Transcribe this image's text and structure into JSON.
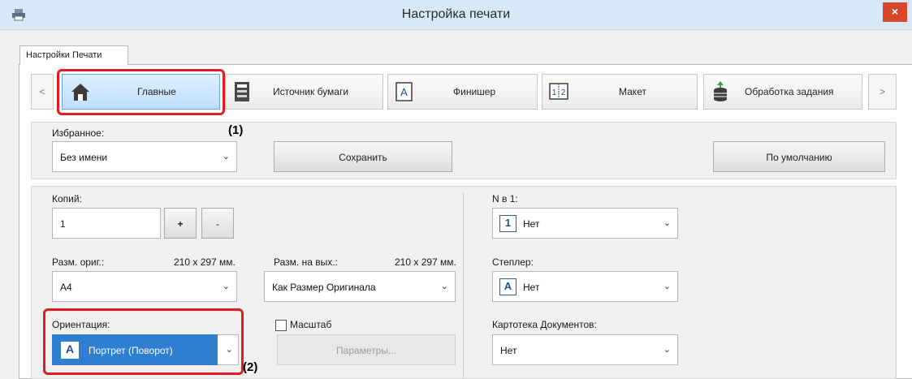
{
  "window": {
    "title": "Настройка печати",
    "close_glyph": "×"
  },
  "tab": {
    "label": "Настройки Печати"
  },
  "nav": {
    "prev_glyph": "<",
    "next_glyph": ">",
    "items": [
      {
        "label": "Главные",
        "icon": "home-icon",
        "selected": true
      },
      {
        "label": "Источник бумаги",
        "icon": "paper-source-icon",
        "selected": false
      },
      {
        "label": "Финишер",
        "icon": "finisher-icon",
        "selected": false
      },
      {
        "label": "Макет",
        "icon": "layout-icon",
        "selected": false
      },
      {
        "label": "Обработка задания",
        "icon": "job-handling-icon",
        "selected": false
      }
    ]
  },
  "callouts": {
    "one": "(1)",
    "two": "(2)"
  },
  "favorites": {
    "label": "Избранное:",
    "value": "Без имени",
    "save_label": "Сохранить",
    "default_label": "По умолчанию"
  },
  "copies": {
    "label": "Копий:",
    "value": "1",
    "plus": "+",
    "minus": "-"
  },
  "original_size": {
    "label": "Разм. ориг.:",
    "dims": "210 x 297 мм.",
    "value": "A4"
  },
  "output_size": {
    "label": "Разм. на вых.:",
    "dims": "210 x 297 мм.",
    "value": "Как Размер Оригинала"
  },
  "orientation": {
    "label": "Ориентация:",
    "value": "Портрет (Поворот)",
    "icon_glyph": "A"
  },
  "scale": {
    "label": "Масштаб",
    "checked": false,
    "params_label": "Параметры..."
  },
  "n_up": {
    "label": "N в 1:",
    "value": "Нет",
    "icon_glyph": "1"
  },
  "stapler": {
    "label": "Степлер:",
    "value": "Нет",
    "icon_glyph": "A"
  },
  "doc_filing": {
    "label": "Картотека Документов:",
    "value": "Нет"
  },
  "colors": {
    "accent": "#2f7ed0",
    "callout_red": "#e31b23",
    "title_bar": "#d7e8f6",
    "close_red": "#d9472b"
  }
}
